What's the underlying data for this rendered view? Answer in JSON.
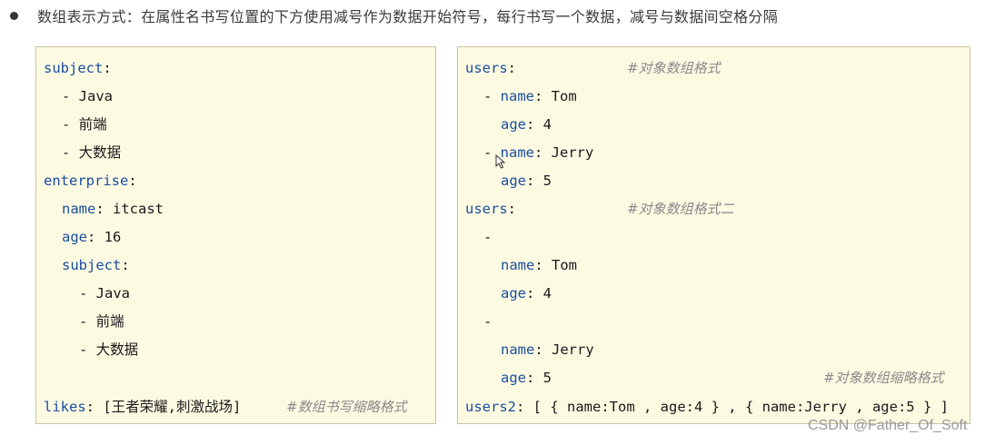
{
  "bullet_text": "数组表示方式：在属性名书写位置的下方使用减号作为数据开始符号，每行书写一个数据，减号与数据间空格分隔",
  "left_panel": {
    "lines": [
      {
        "key": "subject",
        "sep": ":",
        "value": ""
      },
      {
        "key": "",
        "sep": "",
        "value": "- Java"
      },
      {
        "key": "",
        "sep": "",
        "value": "- 前端"
      },
      {
        "key": "",
        "sep": "",
        "value": "- 大数据"
      },
      {
        "key": "enterprise",
        "sep": ":",
        "value": ""
      },
      {
        "key": "name",
        "sep": ":",
        "value": " itcast"
      },
      {
        "key": "age",
        "sep": ":",
        "value": " 16"
      },
      {
        "key": "subject",
        "sep": ":",
        "value": ""
      },
      {
        "key": "",
        "sep": "",
        "value": "- Java"
      },
      {
        "key": "",
        "sep": "",
        "value": "- 前端"
      },
      {
        "key": "",
        "sep": "",
        "value": "- 大数据"
      },
      {
        "key": "likes",
        "sep": ":",
        "value": " [王者荣耀,刺激战场]"
      }
    ],
    "comment": "#数组书写缩略格式"
  },
  "right_panel": {
    "lines": [
      {
        "key": "users",
        "sep": ":",
        "value": ""
      },
      {
        "key": "name",
        "sep": ":",
        "value": " Tom",
        "dash": "- "
      },
      {
        "key": "age",
        "sep": ":",
        "value": " 4"
      },
      {
        "key": "name",
        "sep": ":",
        "value": " Jerry",
        "dash": "- "
      },
      {
        "key": "age",
        "sep": ":",
        "value": " 5"
      },
      {
        "key": "users",
        "sep": ":",
        "value": ""
      },
      {
        "key": "",
        "sep": "",
        "value": "-"
      },
      {
        "key": "name",
        "sep": ":",
        "value": " Tom"
      },
      {
        "key": "age",
        "sep": ":",
        "value": " 4"
      },
      {
        "key": "",
        "sep": "",
        "value": "-"
      },
      {
        "key": "name",
        "sep": ":",
        "value": " Jerry"
      },
      {
        "key": "age",
        "sep": ":",
        "value": " 5"
      },
      {
        "key": "users2",
        "sep": ":",
        "value": " [ { name:Tom , age:4 } , { name:Jerry , age:5 } ]"
      }
    ],
    "comments": [
      "#对象数组格式",
      "#对象数组格式二",
      "#对象数组缩略格式"
    ]
  },
  "watermark": "CSDN @Father_Of_Soft",
  "colors": {
    "key": "#1b4fa0",
    "comment": "#8a8a8a",
    "panel_bg": "#fdfae2",
    "panel_border": "#c9c3a5"
  }
}
